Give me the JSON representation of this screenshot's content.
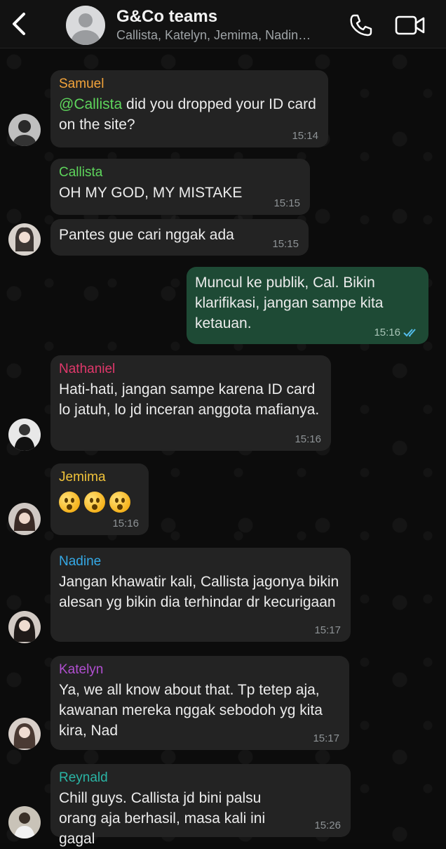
{
  "header": {
    "title": "G&Co teams",
    "subtitle": "Callista, Katelyn, Jemima, Nadin…",
    "icons": [
      "back-icon",
      "group-avatar-icon",
      "phone-icon",
      "video-icon"
    ]
  },
  "colors": {
    "samuel": "#f2a33a",
    "callista": "#5ed55c",
    "nathaniel": "#e0386b",
    "jemima": "#f1c33a",
    "nadine": "#35a9e6",
    "katelyn": "#b04fd0",
    "reynald": "#2ab5a5",
    "outgoing_bubble": "#1e4a35",
    "incoming_bubble": "#232323",
    "read_ticks": "#53bdeb"
  },
  "messages": [
    {
      "sender": "Samuel",
      "mention": "@Callista",
      "text": " did you dropped your ID card on the site?",
      "time": "15:14"
    },
    {
      "sender": "Callista",
      "text": "OH MY GOD, MY MISTAKE",
      "time": "15:15"
    },
    {
      "text": "Pantes gue cari nggak ada",
      "time": "15:15"
    },
    {
      "text": "Muncul ke publik, Cal. Bikin klarifikasi, jangan sampe kita ketauan.",
      "time": "15:16"
    },
    {
      "sender": "Nathaniel",
      "text": "Hati-hati, jangan sampe karena ID card lo jatuh, lo jd inceran anggota mafianya.",
      "time": "15:16"
    },
    {
      "sender": "Jemima",
      "emoji": "😲😲😲",
      "time": "15:16"
    },
    {
      "sender": "Nadine",
      "text": "Jangan khawatir kali, Callista jagonya bikin alesan yg bikin dia terhindar dr kecurigaan",
      "time": "15:17"
    },
    {
      "sender": "Katelyn",
      "text": "Ya, we all know about that. Tp tetep aja, kawanan mereka nggak sebodoh yg kita kira, Nad",
      "time": "15:17"
    },
    {
      "sender": "Reynald",
      "text": "Chill guys. Callista jd bini palsu orang aja berhasil, masa kali ini gagal",
      "time": "15:26"
    }
  ]
}
